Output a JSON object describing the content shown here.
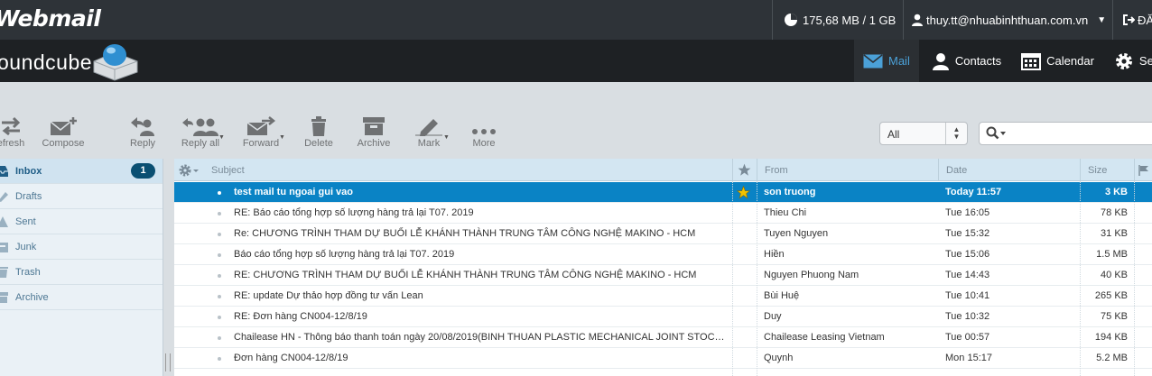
{
  "app": {
    "brand": "Webmail",
    "logo_text": "oundcube",
    "quota": "175,68 MB / 1 GB",
    "user": "thuy.tt@nhuabinhthuan.com.vn",
    "logout_label": "ĐĂ"
  },
  "nav": {
    "tabs": [
      {
        "label": "Mail",
        "icon": "mail-icon",
        "active": true
      },
      {
        "label": "Contacts",
        "icon": "contacts-icon",
        "active": false
      },
      {
        "label": "Calendar",
        "icon": "calendar-icon",
        "active": false
      },
      {
        "label": "Se",
        "icon": "gear-icon",
        "active": false
      }
    ]
  },
  "toolbar": {
    "refresh": "efresh",
    "compose": "Compose",
    "reply": "Reply",
    "reply_all": "Reply all",
    "forward": "Forward",
    "delete": "Delete",
    "archive": "Archive",
    "mark": "Mark",
    "more": "More",
    "filter_value": "All"
  },
  "folders": [
    {
      "name": "Inbox",
      "icon": "inbox-icon",
      "unread": "1",
      "active": true
    },
    {
      "name": "Drafts",
      "icon": "drafts-icon",
      "unread": "",
      "active": false
    },
    {
      "name": "Sent",
      "icon": "sent-icon",
      "unread": "",
      "active": false
    },
    {
      "name": "Junk",
      "icon": "junk-icon",
      "unread": "",
      "active": false
    },
    {
      "name": "Trash",
      "icon": "trash-icon",
      "unread": "",
      "active": false
    },
    {
      "name": "Archive",
      "icon": "archive-icon",
      "unread": "",
      "active": false
    }
  ],
  "list": {
    "columns": {
      "subject": "Subject",
      "from": "From",
      "date": "Date",
      "size": "Size"
    },
    "messages": [
      {
        "subject": "test mail tu ngoai gui vao",
        "from": "son truong",
        "date": "Today 11:57",
        "size": "3 KB",
        "flagged": true,
        "selected": true
      },
      {
        "subject": "RE: Báo cáo tổng hợp số lượng hàng trả lại T07. 2019",
        "from": "Thieu Chi",
        "date": "Tue 16:05",
        "size": "78 KB",
        "flagged": false,
        "selected": false
      },
      {
        "subject": "Re: CHƯƠNG TRÌNH THAM DỰ BUỔI LỄ KHÁNH THÀNH TRUNG TÂM CÔNG NGHỆ MAKINO - HCM",
        "from": "Tuyen Nguyen",
        "date": "Tue 15:32",
        "size": "31 KB",
        "flagged": false,
        "selected": false
      },
      {
        "subject": "Báo cáo tổng hợp số lượng hàng trả lại T07. 2019",
        "from": "Hiền",
        "date": "Tue 15:06",
        "size": "1.5 MB",
        "flagged": false,
        "selected": false
      },
      {
        "subject": "RE: CHƯƠNG TRÌNH THAM DỰ BUỔI LỄ KHÁNH THÀNH TRUNG TÂM CÔNG NGHỆ MAKINO - HCM",
        "from": "Nguyen Phuong Nam",
        "date": "Tue 14:43",
        "size": "40 KB",
        "flagged": false,
        "selected": false
      },
      {
        "subject": "RE: update Dự thảo hợp đồng tư vấn Lean",
        "from": "Bùi Huệ",
        "date": "Tue 10:41",
        "size": "265 KB",
        "flagged": false,
        "selected": false
      },
      {
        "subject": "RE: Đơn hàng CN004-12/8/19",
        "from": "Duy",
        "date": "Tue 10:32",
        "size": "75 KB",
        "flagged": false,
        "selected": false
      },
      {
        "subject": "Chailease HN - Thông báo thanh toán ngày 20/08/2019(BINH THUAN PLASTIC MECHANICAL JOINT STOCK COMPANY)",
        "from": "Chailease Leasing Vietnam",
        "date": "Tue 00:57",
        "size": "194 KB",
        "flagged": false,
        "selected": false
      },
      {
        "subject": "Đơn hàng CN004-12/8/19",
        "from": "Quynh",
        "date": "Mon 15:17",
        "size": "5.2 MB",
        "flagged": false,
        "selected": false
      }
    ]
  },
  "colors": {
    "topbar": "#2e3338",
    "header": "#1e2124",
    "accent": "#0a83c5",
    "badge": "#0a4f72"
  }
}
